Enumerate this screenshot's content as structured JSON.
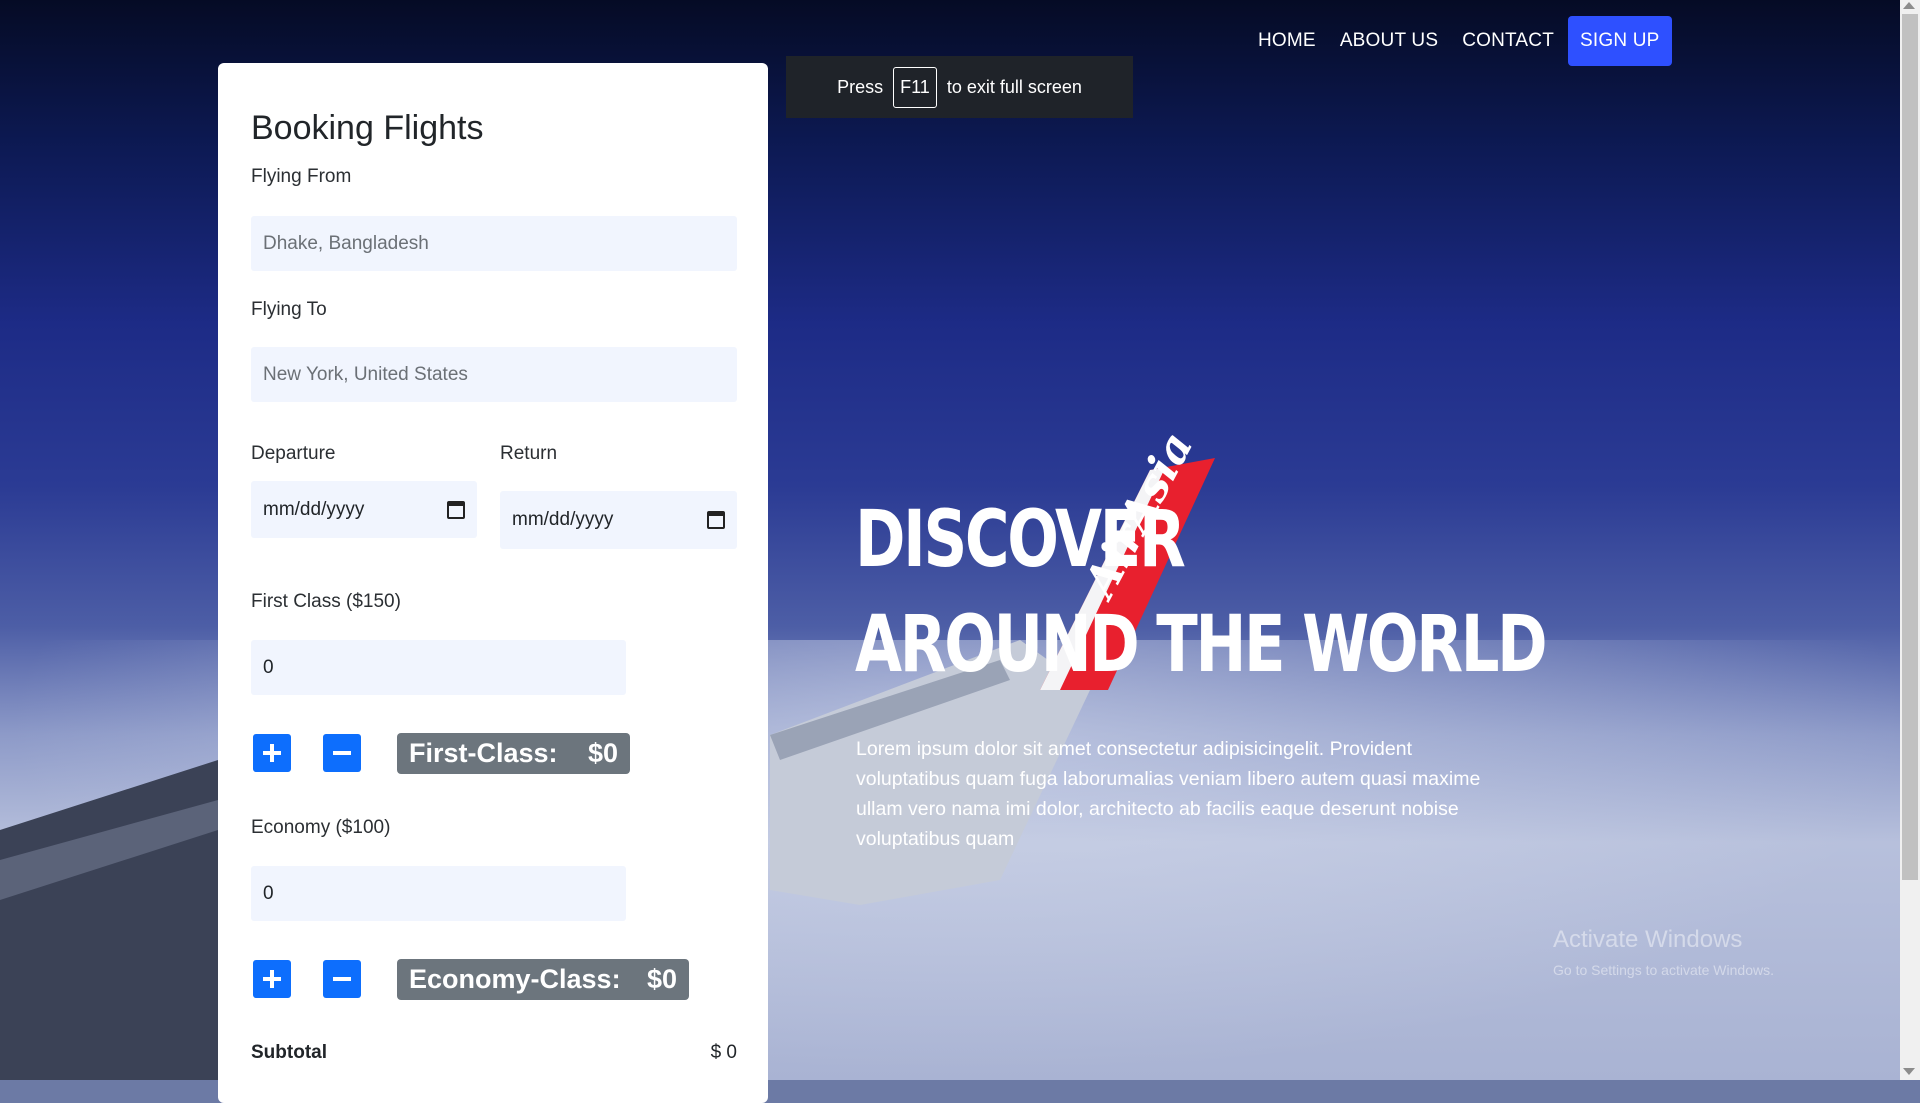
{
  "nav": {
    "home": "HOME",
    "about": "ABOUT US",
    "contact": "CONTACT",
    "signup": "SIGN UP"
  },
  "toast": {
    "press": "Press",
    "key": "F11",
    "rest": "to exit full screen"
  },
  "booking": {
    "title": "Booking Flights",
    "from_label": "Flying From",
    "from_placeholder": "Dhake, Bangladesh",
    "to_label": "Flying To",
    "to_placeholder": "New York, United States",
    "departure_label": "Departure",
    "departure_value": "mm/dd/yyyy",
    "return_label": "Return",
    "return_value": "mm/dd/yyyy",
    "first_label": "First Class ($150)",
    "first_count": "0",
    "first_badge_label": "First-Class:",
    "first_badge_value": "$0",
    "economy_label": "Economy ($100)",
    "economy_count": "0",
    "economy_badge_label": "Economy-Class:",
    "economy_badge_value": "$0",
    "subtotal_label": "Subtotal",
    "subtotal_value": "$ 0"
  },
  "hero": {
    "line1": "DISCOVER",
    "line2": "AROUND THE WORLD",
    "paragraph": "Lorem ipsum dolor sit amet consectetur adipisicingelit. Provident voluptatibus quam fuga laborumalias veniam libero autem quasi maxime ullam vero nama imi dolor, architecto ab facilis eaque deserunt nobise voluptatibus quam",
    "tail_text": "AirAsia"
  },
  "watermark": {
    "line1": "Activate Windows",
    "line2": "Go to Settings to activate Windows."
  },
  "colors": {
    "accent": "#2e50ff",
    "button_blue": "#0d6efd",
    "badge_gray": "#6c757d",
    "input_bg": "#f1f5fe",
    "tail_red": "#e8202e"
  }
}
